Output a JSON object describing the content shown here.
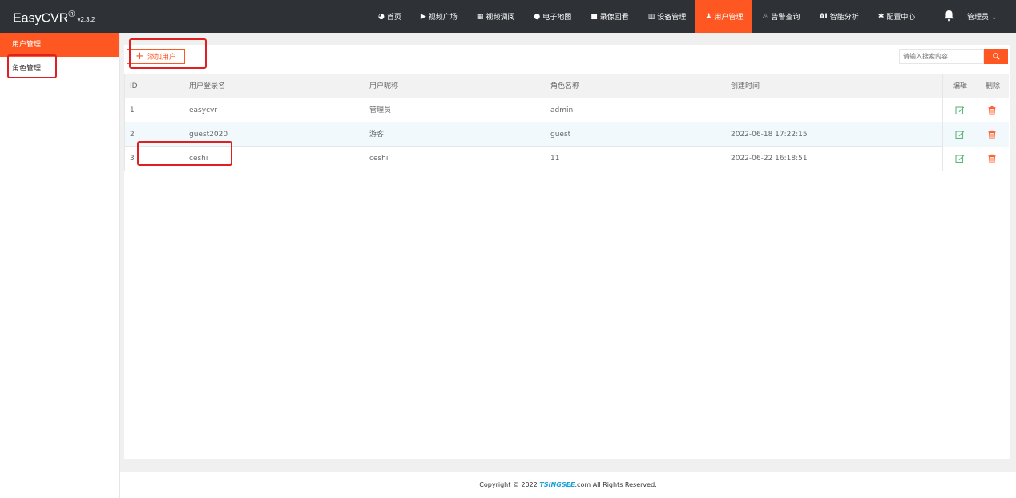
{
  "app": {
    "title": "EasyCVR",
    "trademark": "®",
    "version": "v2.3.2"
  },
  "nav": {
    "items": [
      {
        "label": "首页",
        "icon": "dashboard-icon",
        "glyph": "◕",
        "active": false
      },
      {
        "label": "视频广场",
        "icon": "play-circle-icon",
        "glyph": "▶",
        "active": false
      },
      {
        "label": "视频调阅",
        "icon": "grid-icon",
        "glyph": "▦",
        "active": false
      },
      {
        "label": "电子地图",
        "icon": "map-pin-icon",
        "glyph": "●",
        "active": false
      },
      {
        "label": "录像回看",
        "icon": "video-camera-icon",
        "glyph": "■",
        "active": false
      },
      {
        "label": "设备管理",
        "icon": "device-icon",
        "glyph": "▥",
        "active": false
      },
      {
        "label": "用户管理",
        "icon": "user-icon",
        "glyph": "♟",
        "active": true
      },
      {
        "label": "告警查询",
        "icon": "alarm-icon",
        "glyph": "♨",
        "active": false
      },
      {
        "label": "智能分析",
        "icon": "ai-icon",
        "glyph": "AI",
        "active": false
      },
      {
        "label": "配置中心",
        "icon": "gear-icon",
        "glyph": "✱",
        "active": false
      }
    ],
    "user_label": "管理员",
    "user_caret": "⌄"
  },
  "sidebar": {
    "items": [
      {
        "label": "用户管理",
        "active": true
      },
      {
        "label": "角色管理",
        "active": false
      }
    ]
  },
  "toolbar": {
    "add_plus": "+",
    "add_label": "添加用户",
    "search_placeholder": "请输入搜索内容"
  },
  "table": {
    "headers": {
      "id": "ID",
      "login": "用户登录名",
      "nickname": "用户昵称",
      "role": "角色名称",
      "created": "创建时间",
      "edit": "编辑",
      "delete": "删除"
    },
    "rows": [
      {
        "id": "1",
        "login": "easycvr",
        "nickname": "管理员",
        "role": "admin",
        "created": ""
      },
      {
        "id": "2",
        "login": "guest2020",
        "nickname": "游客",
        "role": "guest",
        "created": "2022-06-18 17:22:15"
      },
      {
        "id": "3",
        "login": "ceshi",
        "nickname": "ceshi",
        "role": "11",
        "created": "2022-06-22 16:18:51"
      }
    ]
  },
  "footer": {
    "prefix": "Copyright © 2022 ",
    "brand": "TSINGSEE",
    "suffix": ".com All Rights Reserved."
  },
  "colors": {
    "accent": "#ff5722",
    "topbar": "#2e3136",
    "edit_icon": "#5fb878",
    "delete_icon": "#ff5722",
    "annotation": "#e02020"
  }
}
